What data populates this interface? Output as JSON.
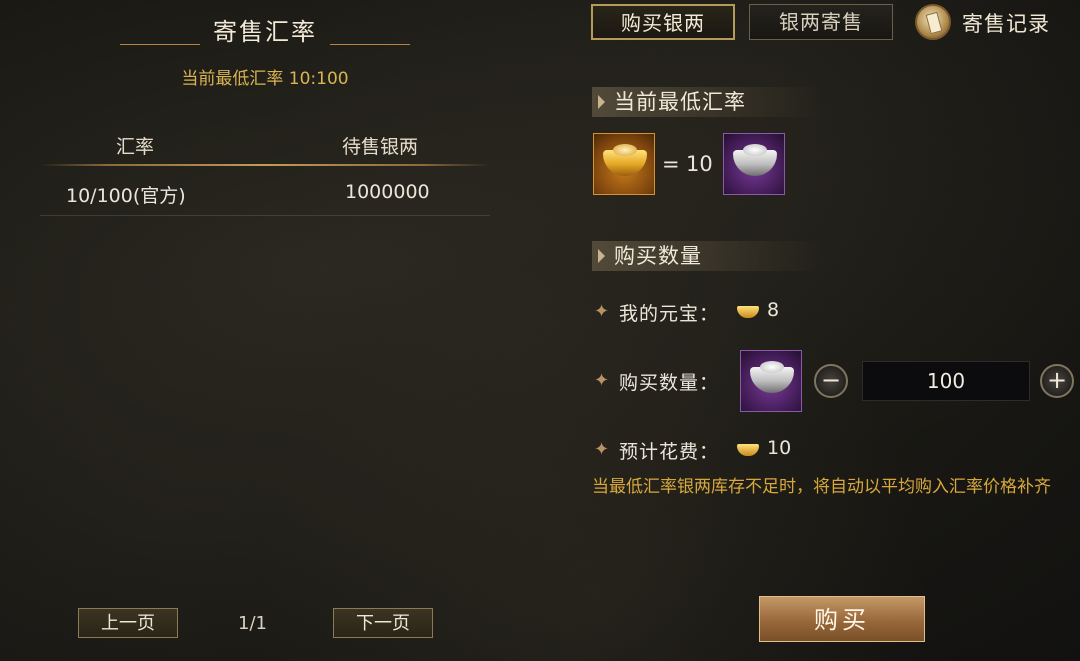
{
  "left_panel": {
    "title": "寄售汇率",
    "subtitle": "当前最低汇率 10:100",
    "columns": [
      "汇率",
      "待售银两"
    ],
    "rows": [
      {
        "rate": "10/100(官方)",
        "amount": "1000000"
      }
    ],
    "prev_label": "上一页",
    "page_indicator": "1/1",
    "next_label": "下一页"
  },
  "tabs": {
    "buy_silver": "购买银两",
    "sell_silver": "银两寄售",
    "records": "寄售记录"
  },
  "rate_section": {
    "header": "当前最低汇率",
    "equals": "=",
    "value": "10"
  },
  "quantity_section": {
    "header": "购买数量",
    "my_yuanbao_label": "我的元宝：",
    "my_yuanbao_value": "8",
    "buy_qty_label": "购买数量：",
    "buy_qty_value": "100",
    "decrement_symbol": "−",
    "increment_symbol": "+",
    "est_cost_label": "预计花费：",
    "est_cost_value": "10"
  },
  "note": "当最低汇率银两库存不足时，将自动以平均购入汇率价格补齐",
  "buy_button": "购买",
  "colors": {
    "accent_gold": "#d9b451",
    "note_orange": "#d9a83c",
    "button_bronze": "#98683a"
  },
  "icons": [
    "gold-ingot-icon",
    "silver-ingot-icon",
    "scroll-record-icon",
    "bullet-star-icon",
    "minus-icon",
    "plus-icon"
  ]
}
